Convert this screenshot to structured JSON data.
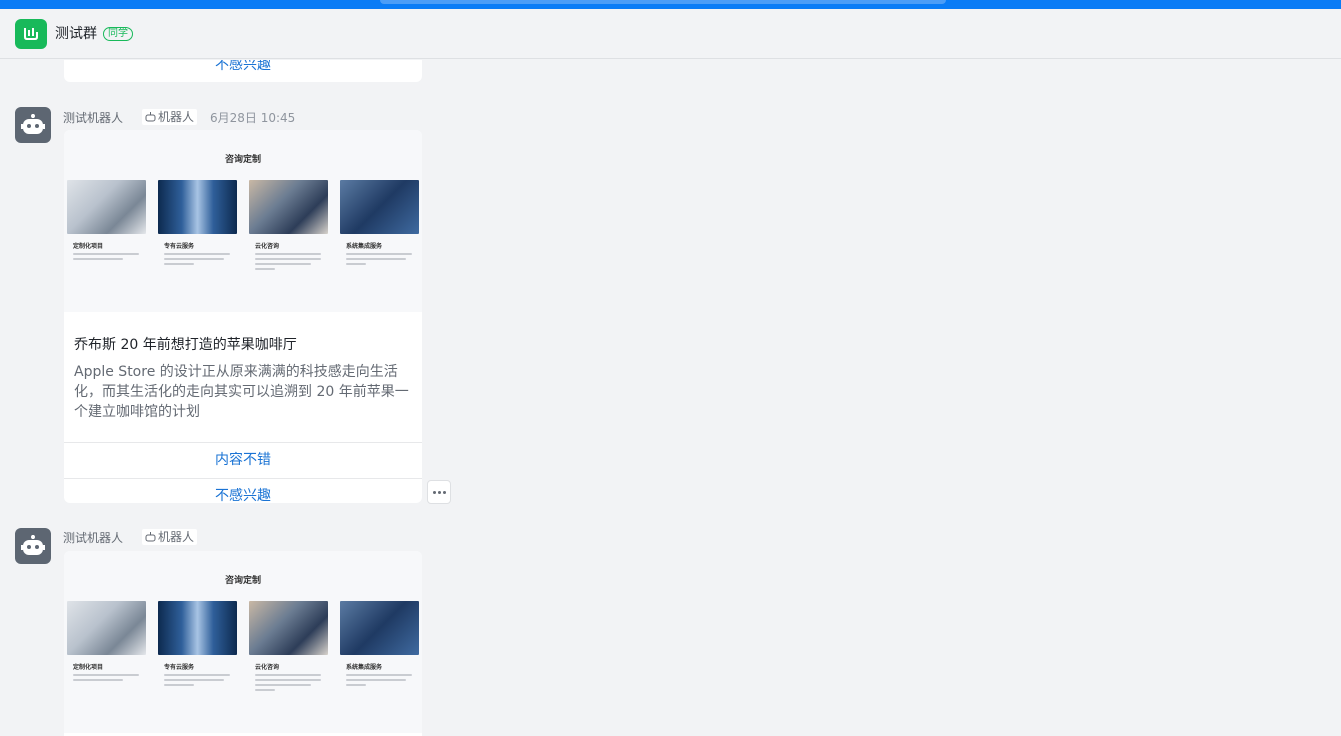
{
  "header": {
    "title": "测试群",
    "tag": "同学"
  },
  "first_card_partial": {
    "action": "不感兴趣"
  },
  "messages": [
    {
      "sender": "测试机器人",
      "badge": "机器人",
      "time": "6月28日 10:45",
      "preview": {
        "title": "咨询定制",
        "items": [
          "定制化项目",
          "专有云服务",
          "云化咨询",
          "系统集成服务"
        ]
      },
      "article_title": "乔布斯 20 年前想打造的苹果咖啡厅",
      "article_desc": "Apple Store 的设计正从原来满满的科技感走向生活化，而其生活化的走向其实可以追溯到 20 年前苹果一个建立咖啡馆的计划",
      "actions": [
        "内容不错",
        "不感兴趣"
      ]
    },
    {
      "sender": "测试机器人",
      "badge": "机器人",
      "preview": {
        "title": "咨询定制",
        "items": [
          "定制化项目",
          "专有云服务",
          "云化咨询",
          "系统集成服务"
        ]
      }
    }
  ],
  "colors": {
    "accent": "#0a7cf6",
    "link": "#1a73d4",
    "group_green": "#18b95a"
  }
}
